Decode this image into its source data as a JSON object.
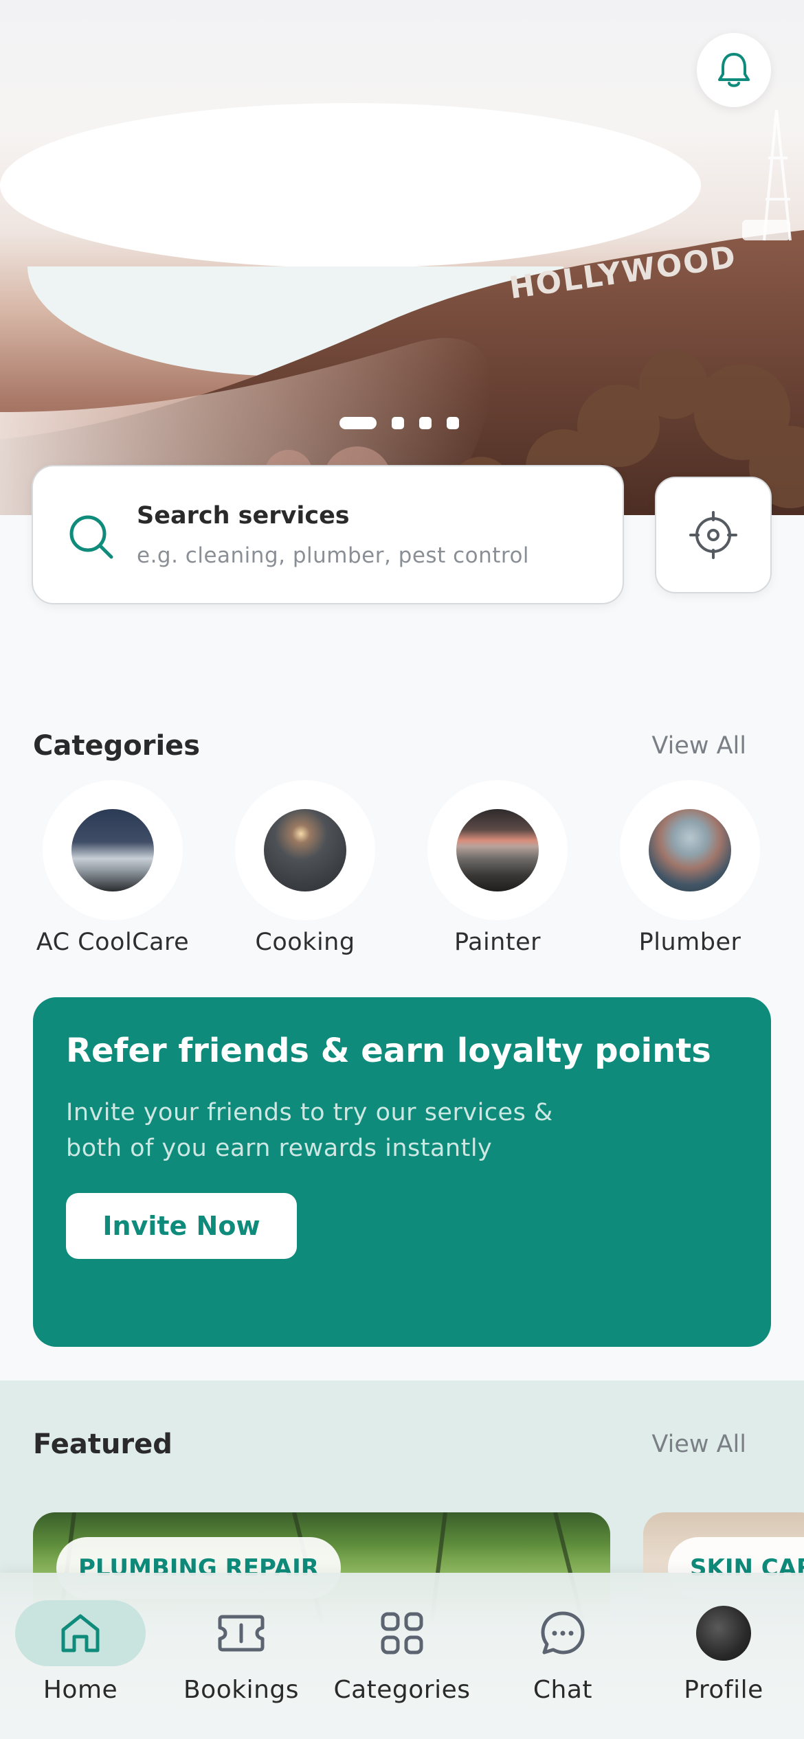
{
  "hero": {
    "carousel_pages": 4,
    "active_page": 1,
    "sign_text": "HOLLYWOOD"
  },
  "search": {
    "title": "Search services",
    "placeholder": "e.g. cleaning, plumber, pest control"
  },
  "categories": {
    "title": "Categories",
    "view_all": "View All",
    "items": [
      {
        "label": "AC CoolCare",
        "icon": "mountain-photo"
      },
      {
        "label": "Cooking",
        "icon": "sparkler-photo"
      },
      {
        "label": "Painter",
        "icon": "field-sunset-photo"
      },
      {
        "label": "Plumber",
        "icon": "hands-plant-photo"
      }
    ]
  },
  "refer": {
    "title": "Refer friends & earn loyalty points",
    "text": "Invite your friends to try our services & both of you earn rewards instantly",
    "button": "Invite Now"
  },
  "featured": {
    "title": "Featured",
    "view_all": "View All",
    "cards": [
      {
        "tag": "PLUMBING REPAIR"
      },
      {
        "tag": "SKIN CARE"
      }
    ]
  },
  "nav": {
    "items": [
      {
        "label": "Home",
        "icon": "home-icon",
        "active": true
      },
      {
        "label": "Bookings",
        "icon": "ticket-icon",
        "active": false
      },
      {
        "label": "Categories",
        "icon": "grid-icon",
        "active": false
      },
      {
        "label": "Chat",
        "icon": "chat-icon",
        "active": false
      },
      {
        "label": "Profile",
        "icon": "avatar",
        "active": false
      }
    ]
  },
  "colors": {
    "accent": "#0e8b7b",
    "accent_light": "#c9e4df",
    "featured_bg": "#e0ecea"
  }
}
